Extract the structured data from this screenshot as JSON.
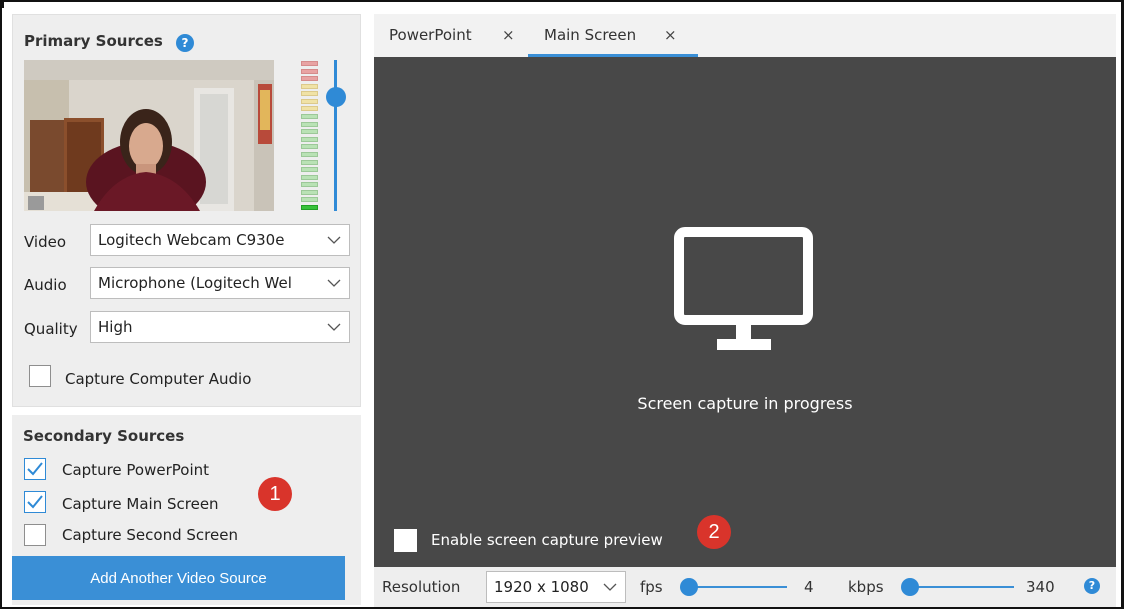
{
  "primary_sources": {
    "title": "Primary Sources",
    "help_icon": "?",
    "audio_level_fraction": 0.05,
    "volume_fraction": 0.75,
    "video_label": "Video",
    "video_value": "Logitech Webcam C930e",
    "audio_label": "Audio",
    "audio_value": "Microphone (Logitech Wel",
    "quality_label": "Quality",
    "quality_value": "High",
    "capture_audio_label": "Capture Computer Audio",
    "capture_audio_checked": false
  },
  "secondary_sources": {
    "title": "Secondary Sources",
    "items": [
      {
        "label": "Capture PowerPoint",
        "checked": true
      },
      {
        "label": "Capture Main Screen",
        "checked": true
      },
      {
        "label": "Capture Second Screen",
        "checked": false
      }
    ],
    "add_button_label": "Add Another Video Source"
  },
  "annotations": {
    "badge_1": "1",
    "badge_2": "2",
    "color": "#d9342b"
  },
  "tabs": [
    {
      "label": "PowerPoint",
      "close": "×",
      "active": false
    },
    {
      "label": "Main Screen",
      "close": "×",
      "active": true
    }
  ],
  "preview": {
    "icon": "monitor-icon",
    "status_text": "Screen capture in progress",
    "enable_preview_label": "Enable screen capture preview",
    "enable_preview_checked": false
  },
  "bottom_bar": {
    "resolution_label": "Resolution",
    "resolution_value": "1920 x 1080",
    "fps_label": "fps",
    "fps_value": "4",
    "kbps_label": "kbps",
    "kbps_value": "340",
    "help_icon": "?"
  },
  "colors": {
    "accent": "#3a8fd6",
    "preview_bg": "#484848",
    "panel_bg": "#eeeeee"
  }
}
